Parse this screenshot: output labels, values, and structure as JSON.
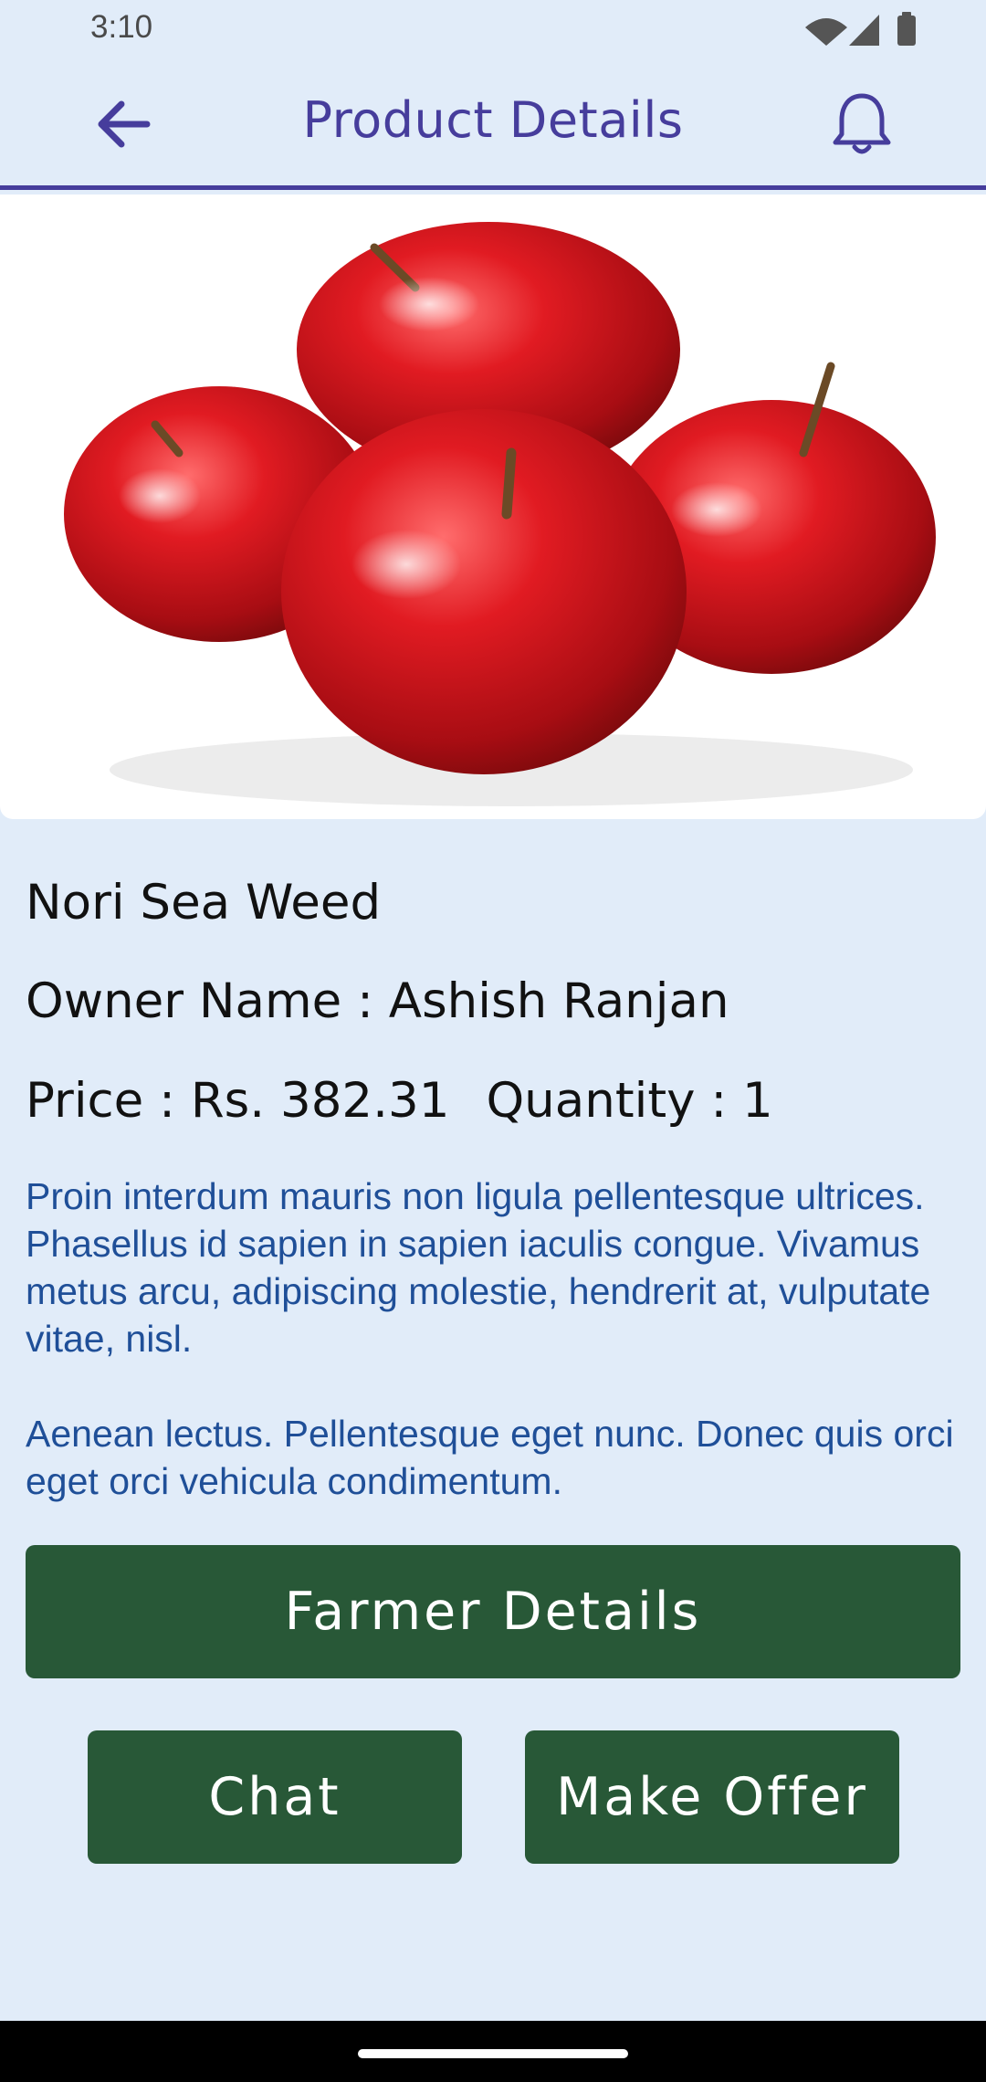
{
  "status_bar": {
    "time": "3:10"
  },
  "app_bar": {
    "title": "Product Details",
    "back_icon": "arrow-left-icon",
    "notification_icon": "bell-icon",
    "accent_color": "#463d9c"
  },
  "product": {
    "image": "red-apples",
    "name": "Nori Sea Weed",
    "owner_line": "Owner Name : Ashish Ranjan",
    "price_line": "Price : Rs. 382.31",
    "quantity_line": "Quantity : 1",
    "description_1": "Proin interdum mauris non ligula pellentesque ultrices. Phasellus id sapien in sapien iaculis congue. Vivamus metus arcu, adipiscing molestie, hendrerit at, vulputate vitae, nisl.",
    "description_2": "Aenean lectus. Pellentesque eget nunc. Donec quis orci eget orci vehicula condimentum."
  },
  "actions": {
    "farmer_details": "Farmer Details",
    "chat": "Chat",
    "make_offer": "Make Offer",
    "button_color": "#285837"
  }
}
